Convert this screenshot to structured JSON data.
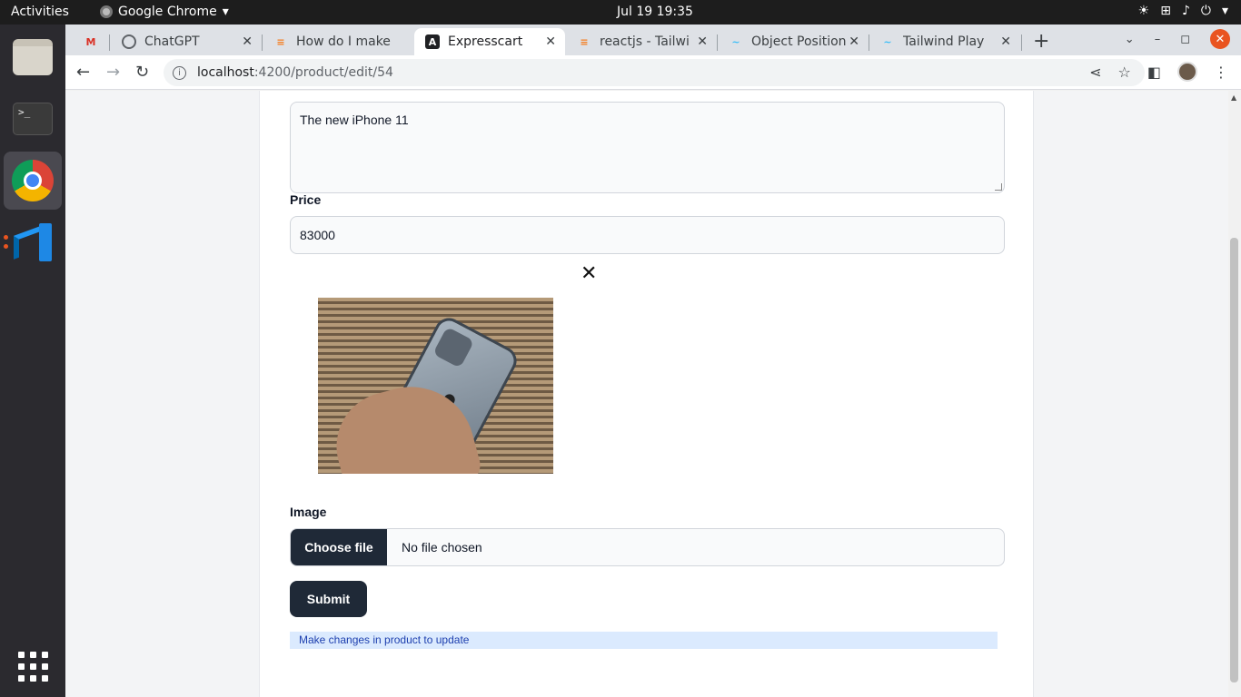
{
  "topbar": {
    "activities": "Activities",
    "app_name": "Google Chrome",
    "clock": "Jul 19  19:35"
  },
  "dock": {
    "items": [
      "files-icon",
      "terminal-icon",
      "chrome-icon",
      "vscode-icon",
      "app-grid-icon"
    ]
  },
  "browser": {
    "tabs": [
      {
        "title": "",
        "icon": "gmail-icon"
      },
      {
        "title": "ChatGPT",
        "icon": "chatgpt-icon"
      },
      {
        "title": "How do I make",
        "icon": "stackoverflow-icon"
      },
      {
        "title": "Expresscart",
        "icon": "angular-icon"
      },
      {
        "title": "reactjs - Tailwi",
        "icon": "stackoverflow-icon"
      },
      {
        "title": "Object Position",
        "icon": "tailwind-icon"
      },
      {
        "title": "Tailwind Play",
        "icon": "tailwind-icon"
      }
    ],
    "url_host": "localhost",
    "url_path": ":4200/product/edit/54"
  },
  "form": {
    "description_value": "The new iPhone 11",
    "price_label": "Price",
    "price_value": "83000",
    "image_label": "Image",
    "choose_file_label": "Choose file",
    "no_file_text": "No file chosen",
    "submit_label": "Submit",
    "info_message": "Make changes in product to update"
  },
  "colors": {
    "button_bg": "#1f2937",
    "info_bg": "#dbeafe",
    "info_text": "#1e40af",
    "ubuntu_accent": "#e95420"
  }
}
